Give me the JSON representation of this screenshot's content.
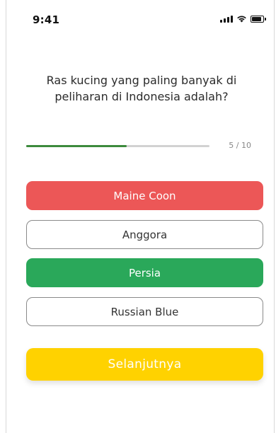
{
  "status_bar": {
    "time": "9:41",
    "icons": [
      "signal-icon",
      "wifi-icon",
      "battery-icon"
    ]
  },
  "quiz": {
    "question": "Ras kucing yang paling banyak di peliharan di Indonesia adalah?",
    "progress": {
      "current": 5,
      "total": 10,
      "label": "5 / 10",
      "fraction": 0.55,
      "color": "#3c8a3c"
    },
    "options": [
      {
        "label": "Maine Coon",
        "state": "wrong",
        "color": "#ec5757"
      },
      {
        "label": "Anggora",
        "state": "neutral"
      },
      {
        "label": "Persia",
        "state": "correct",
        "color": "#2aa85a"
      },
      {
        "label": "Russian Blue",
        "state": "neutral"
      }
    ],
    "next_label": "Selanjutnya",
    "next_color": "#ffd200"
  }
}
